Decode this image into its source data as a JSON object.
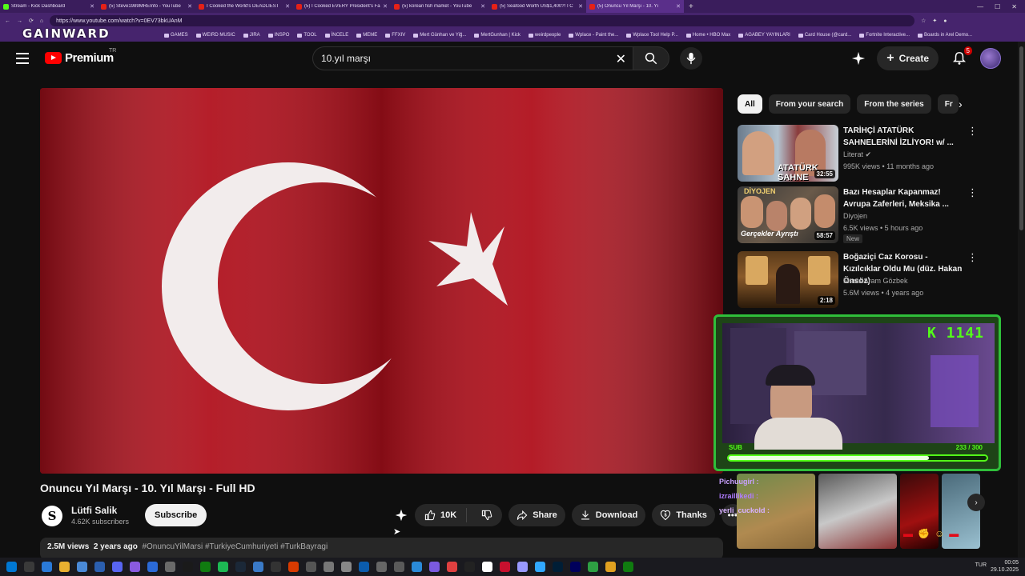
{
  "browser": {
    "tabs": [
      {
        "label": "Stream - Kick Dashboard",
        "type": "kick"
      },
      {
        "label": "(5) Steve1989MREInfo - YouTube",
        "type": "yt"
      },
      {
        "label": "I Cooked the World's DEADLIEST",
        "type": "yt"
      },
      {
        "label": "(5) I Cooked EVERY President's Fa",
        "type": "yt"
      },
      {
        "label": "(5) korean fish market - YouTube",
        "type": "yt"
      },
      {
        "label": "(5) Seafood Worth US$1,400?! I C",
        "type": "yt"
      },
      {
        "label": "(5) Onuncu Yıl Marşı - 10. Yı",
        "type": "yt",
        "active": true
      }
    ],
    "url": "https://www.youtube.com/watch?v=0EV73bkUAnM",
    "bookmarks": [
      "GAMES",
      "WEIRD MUSIC",
      "JIRA",
      "INSPO",
      "TOOL",
      "İNCELE",
      "MEME",
      "FFXIV",
      "Mert Günhan ve Yiğ...",
      "MertGunhan | Kick",
      "weirdpeople",
      "Wplace - Paint the...",
      "Wplace Tool Help P...",
      "Home • HBO Max",
      "AGABEY YAYINLARI",
      "Card House (@card...",
      "Fortnite Interactive...",
      "Boards in Arel Demo..."
    ],
    "overlay_brand": "GAINWARD"
  },
  "header": {
    "logo_text": "Premium",
    "logo_region": "TR",
    "search_value": "10.yıl marşı",
    "create_label": "Create",
    "notifications": "5"
  },
  "video": {
    "title": "Onuncu Yıl Marşı - 10. Yıl Marşı - Full HD",
    "channel": "Lütfi Salik",
    "channel_initial": "S",
    "subscribers": "4.62K subscribers",
    "subscribe_label": "Subscribe",
    "likes": "10K",
    "share_label": "Share",
    "download_label": "Download",
    "thanks_label": "Thanks",
    "views": "2.5M views",
    "age": "2 years ago",
    "hashtags": "#OnuncuYilMarsi #TurkiyeCumhuriyeti #TurkBayragi"
  },
  "chips": [
    "All",
    "From your search",
    "From the series",
    "Fr"
  ],
  "recommendations": [
    {
      "title": "TARİHÇİ ATATÜRK SAHNELERİNİ İZLİYOR! w/ ...",
      "channel": "Literat",
      "meta": "995K views • 11 months ago",
      "duration": "32:55",
      "thumb_text": "ATATÜRK SAHNE"
    },
    {
      "title": "Bazı Hesaplar Kapanmaz! Avrupa Zaferleri, Meksika ...",
      "channel": "Diyojen",
      "meta": "6.5K views • 5 hours ago",
      "duration": "58:57",
      "badge": "New",
      "thumb_text": "Gerçekler Ayrıştı"
    },
    {
      "title": "Boğaziçi Caz Korosu - Kızılcıklar Oldu Mu (düz. Hakan Önsöz)",
      "channel": "Masis Aram Gözbek",
      "meta": "5.6M views • 4 years ago",
      "duration": "2:18"
    }
  ],
  "stream": {
    "kick_count": "K 1141",
    "sub_label": "SUB",
    "sub_count": "233 / 300",
    "sub_progress": 0.7767,
    "chat": [
      "Pichuugirl :",
      "izraillikedi :",
      "yerli_cuckold :"
    ]
  },
  "taskbar": {
    "lang": "TUR",
    "time": "00:05",
    "date": "29.10.2025"
  },
  "colors": {
    "kick_green": "#53fc18",
    "yt_red": "#ff0000",
    "flag_red": "#c8102e"
  }
}
